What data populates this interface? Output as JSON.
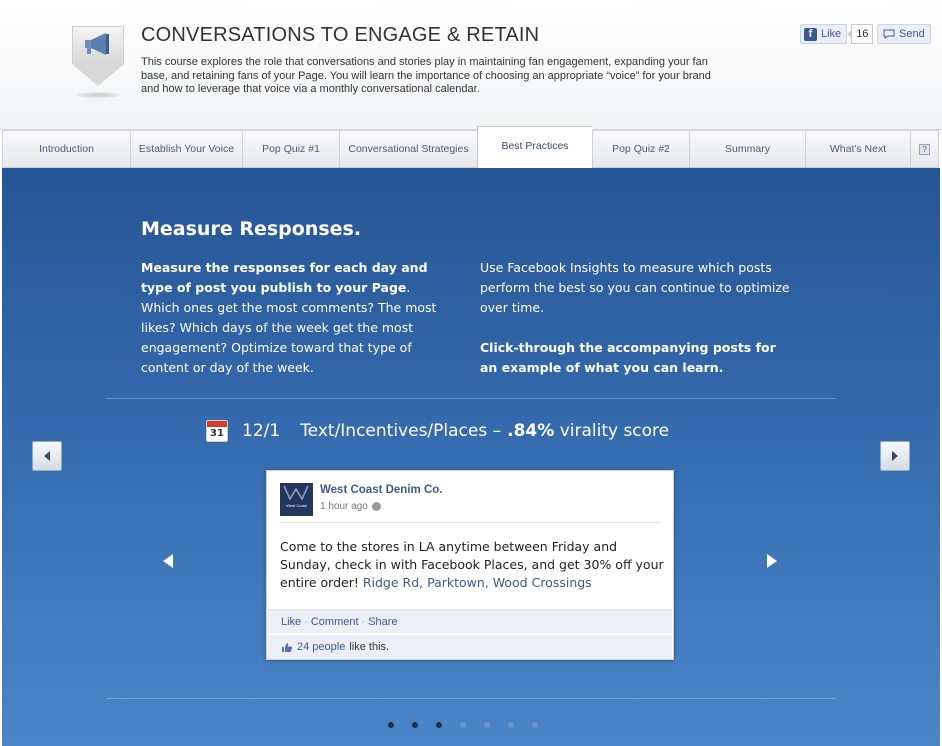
{
  "header": {
    "title": "CONVERSATIONS TO ENGAGE & RETAIN",
    "description": "This course explores the role that conversations and stories play in maintaining fan engagement, expanding your fan base, and retaining fans of your Page. You will learn the importance of choosing an appropriate “voice” for your brand and how to leverage that voice via a monthly conversational calendar.",
    "like_label": "Like",
    "like_count": "16",
    "send_label": "Send",
    "badge_icon": "megaphone-icon"
  },
  "tabs": [
    {
      "label": "Introduction",
      "active": false
    },
    {
      "label": "Establish Your Voice",
      "active": false
    },
    {
      "label": "Pop Quiz #1",
      "active": false
    },
    {
      "label": "Conversational Strategies",
      "active": false
    },
    {
      "label": "Best Practices",
      "active": true
    },
    {
      "label": "Pop Quiz #2",
      "active": false
    },
    {
      "label": "Summary",
      "active": false
    },
    {
      "label": "What's Next",
      "active": false
    }
  ],
  "help_label": "?",
  "main": {
    "title": "Measure Responses.",
    "left_bold": "Measure the responses for each day and type of post you publish to your Page",
    "left_rest": ". Which ones get the most comments? The most likes? Which days of the week get the most engagement? Optimize toward that type of content or day of the week.",
    "right_para1": "Use Facebook Insights to measure which posts perform the best so you can continue to optimize over time.",
    "right_para2": "Click-through the accompanying posts for an example of what you can learn."
  },
  "post_header": {
    "calendar_day": "31",
    "date": "12/1",
    "category": "Text/Incentives/Places –",
    "score": ".84%",
    "score_label": "virality score"
  },
  "post": {
    "page_name": "West Coast Denim Co.",
    "avatar_text": "West Coast",
    "time": "1 hour ago",
    "text": "Come to the stores in LA anytime between Friday and Sunday, check in with Facebook Places, and get 30% off your entire order!",
    "link_text": "Ridge Rd, Parktown, Wood Crossings",
    "actions": [
      "Like",
      "Comment",
      "Share"
    ],
    "likes_count": "24 people",
    "likes_suffix": "like this."
  },
  "pagination": {
    "total": 7,
    "active": [
      0,
      1,
      2
    ]
  },
  "colors": {
    "accent": "#3b5998",
    "main_bg": "#2f63a6"
  }
}
